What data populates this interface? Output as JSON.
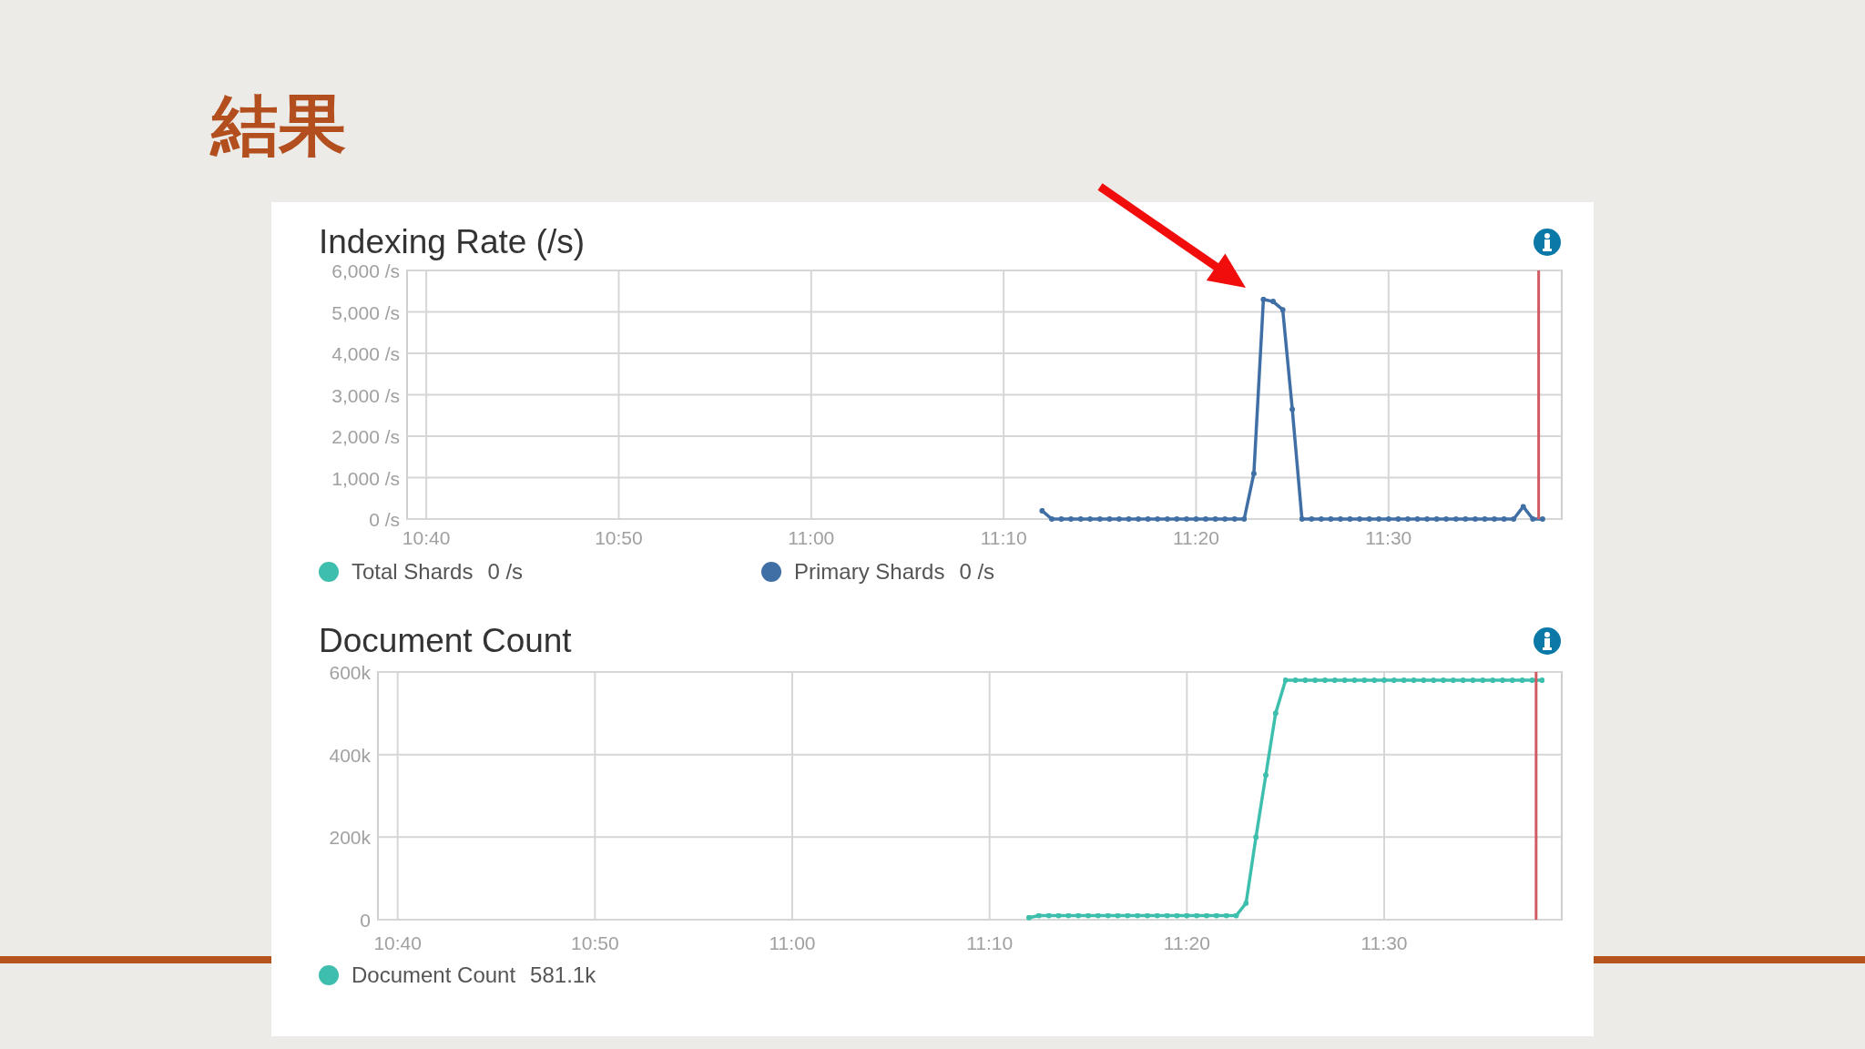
{
  "slide": {
    "title": "結果"
  },
  "charts": [
    {
      "title": "Indexing Rate (/s)",
      "chart_data": {
        "type": "line",
        "categories": [
          null,
          null,
          "10:40",
          null,
          null,
          null,
          null,
          null,
          null,
          null,
          null,
          null,
          null,
          null,
          null,
          null,
          null,
          null,
          null,
          null,
          null,
          null,
          "10:50",
          null,
          null,
          null,
          null,
          null,
          null,
          null,
          null,
          null,
          null,
          null,
          null,
          null,
          null,
          null,
          null,
          null,
          null,
          null,
          "11:00",
          null,
          null,
          null,
          null,
          null,
          null,
          null,
          null,
          null,
          null,
          null,
          null,
          null,
          null,
          null,
          null,
          null,
          null,
          null,
          "11:10",
          null,
          null,
          null,
          null,
          null,
          null,
          null,
          null,
          null,
          null,
          null,
          null,
          null,
          null,
          null,
          null,
          null,
          null,
          null,
          "11:20",
          null,
          null,
          null,
          null,
          null,
          null,
          null,
          null,
          null,
          null,
          null,
          null,
          null,
          null,
          null,
          null,
          null,
          null,
          null,
          "11:30",
          null,
          null,
          null,
          null,
          null,
          null,
          null,
          null,
          null,
          null,
          null,
          null,
          null,
          null,
          null,
          null,
          null,
          null
        ],
        "series": [
          {
            "name": "Primary Shards",
            "color": "#3f6fa5",
            "values": [
              null,
              null,
              null,
              null,
              null,
              null,
              null,
              null,
              null,
              null,
              null,
              null,
              null,
              null,
              null,
              null,
              null,
              null,
              null,
              null,
              null,
              null,
              null,
              null,
              null,
              null,
              null,
              null,
              null,
              null,
              null,
              null,
              null,
              null,
              null,
              null,
              null,
              null,
              null,
              null,
              null,
              null,
              null,
              null,
              null,
              null,
              null,
              null,
              null,
              null,
              null,
              null,
              null,
              null,
              null,
              null,
              null,
              null,
              null,
              null,
              null,
              null,
              null,
              null,
              null,
              null,
              200,
              0,
              0,
              0,
              0,
              0,
              0,
              0,
              0,
              0,
              0,
              0,
              0,
              0,
              0,
              0,
              0,
              0,
              0,
              0,
              0,
              0,
              1100,
              5300,
              5250,
              5050,
              2650,
              0,
              0,
              0,
              0,
              0,
              0,
              0,
              0,
              0,
              0,
              0,
              0,
              0,
              0,
              0,
              0,
              0,
              0,
              0,
              0,
              0,
              0,
              0,
              300,
              0,
              0,
              null,
              null
            ]
          }
        ],
        "grid": true,
        "ylim": [
          0,
          6000
        ],
        "yticks": [
          {
            "value": 0,
            "label": "0 /s"
          },
          {
            "value": 1000,
            "label": "1,000 /s"
          },
          {
            "value": 2000,
            "label": "2,000 /s"
          },
          {
            "value": 3000,
            "label": "3,000 /s"
          },
          {
            "value": 4000,
            "label": "4,000 /s"
          },
          {
            "value": 5000,
            "label": "5,000 /s"
          },
          {
            "value": 6000,
            "label": "6,000 /s"
          }
        ]
      },
      "legend": [
        {
          "kind": "extra",
          "label": "Total Shards",
          "value": "0 /s",
          "color": "#3ebfae"
        },
        {
          "kind": "series",
          "value": "0 /s"
        }
      ]
    },
    {
      "title": "Document Count",
      "chart_data": {
        "type": "line",
        "categories": [
          null,
          null,
          "10:40",
          null,
          null,
          null,
          null,
          null,
          null,
          null,
          null,
          null,
          null,
          null,
          null,
          null,
          null,
          null,
          null,
          null,
          null,
          null,
          "10:50",
          null,
          null,
          null,
          null,
          null,
          null,
          null,
          null,
          null,
          null,
          null,
          null,
          null,
          null,
          null,
          null,
          null,
          null,
          null,
          "11:00",
          null,
          null,
          null,
          null,
          null,
          null,
          null,
          null,
          null,
          null,
          null,
          null,
          null,
          null,
          null,
          null,
          null,
          null,
          null,
          "11:10",
          null,
          null,
          null,
          null,
          null,
          null,
          null,
          null,
          null,
          null,
          null,
          null,
          null,
          null,
          null,
          null,
          null,
          null,
          null,
          "11:20",
          null,
          null,
          null,
          null,
          null,
          null,
          null,
          null,
          null,
          null,
          null,
          null,
          null,
          null,
          null,
          null,
          null,
          null,
          null,
          "11:30",
          null,
          null,
          null,
          null,
          null,
          null,
          null,
          null,
          null,
          null,
          null,
          null,
          null,
          null,
          null,
          null,
          null,
          null
        ],
        "series": [
          {
            "name": "Document Count",
            "color": "#3ebfae",
            "values": [
              null,
              null,
              null,
              null,
              null,
              null,
              null,
              null,
              null,
              null,
              null,
              null,
              null,
              null,
              null,
              null,
              null,
              null,
              null,
              null,
              null,
              null,
              null,
              null,
              null,
              null,
              null,
              null,
              null,
              null,
              null,
              null,
              null,
              null,
              null,
              null,
              null,
              null,
              null,
              null,
              null,
              null,
              null,
              null,
              null,
              null,
              null,
              null,
              null,
              null,
              null,
              null,
              null,
              null,
              null,
              null,
              null,
              null,
              null,
              null,
              null,
              null,
              null,
              null,
              null,
              null,
              5000,
              10000,
              10000,
              10000,
              10000,
              10000,
              10000,
              10000,
              10000,
              10000,
              10000,
              10000,
              10000,
              10000,
              10000,
              10000,
              10000,
              10000,
              10000,
              10000,
              10000,
              10000,
              40000,
              200000,
              350000,
              500000,
              580000,
              580000,
              580000,
              580000,
              580000,
              580000,
              580000,
              580000,
              580000,
              580000,
              580000,
              580000,
              580000,
              580000,
              580000,
              580000,
              580000,
              580000,
              580000,
              580000,
              580000,
              580000,
              580000,
              580000,
              580000,
              580000,
              580000,
              null,
              null
            ]
          }
        ],
        "grid": true,
        "ylim": [
          0,
          600000
        ],
        "yticks": [
          {
            "value": 0,
            "label": "0"
          },
          {
            "value": 200000,
            "label": "200k"
          },
          {
            "value": 400000,
            "label": "400k"
          },
          {
            "value": 600000,
            "label": "600k"
          }
        ]
      },
      "legend": [
        {
          "kind": "series",
          "value": "581.1k"
        }
      ]
    }
  ]
}
